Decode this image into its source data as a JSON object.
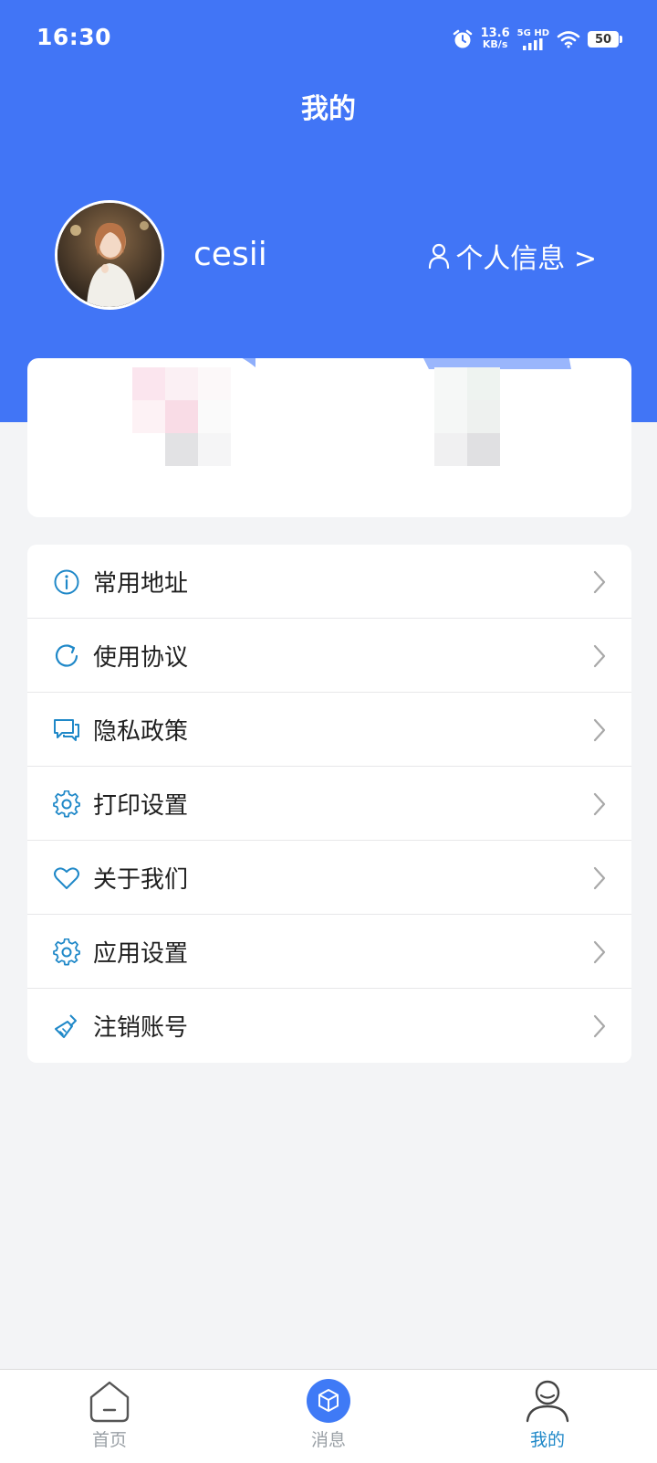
{
  "status_bar": {
    "time": "16:30",
    "net_speed_value": "13.6",
    "net_speed_unit": "KB/s",
    "network_type": "5G HD",
    "battery": "50",
    "icons": [
      "alarm-icon",
      "signal-icon",
      "wifi-icon",
      "battery-icon"
    ]
  },
  "header": {
    "title": "我的"
  },
  "profile": {
    "username": "cesii",
    "info_link": "个人信息 >"
  },
  "menu": {
    "items": [
      {
        "label": "常用地址",
        "icon": "info-icon"
      },
      {
        "label": "使用协议",
        "icon": "refresh-icon"
      },
      {
        "label": "隐私政策",
        "icon": "chat-icon"
      },
      {
        "label": "打印设置",
        "icon": "gear-icon"
      },
      {
        "label": "关于我们",
        "icon": "heart-icon"
      },
      {
        "label": "应用设置",
        "icon": "gear-icon"
      },
      {
        "label": "注销账号",
        "icon": "broom-icon"
      }
    ]
  },
  "tab_bar": {
    "tabs": [
      {
        "label": "首页",
        "icon": "home-icon",
        "active": false
      },
      {
        "label": "消息",
        "icon": "cube-icon",
        "active": false
      },
      {
        "label": "我的",
        "icon": "user-icon",
        "active": true
      }
    ]
  },
  "colors": {
    "header_blue": "#4175f6",
    "icon_blue": "#1f88c8",
    "active_tab": "#1f88c8",
    "background": "#f3f4f6"
  }
}
